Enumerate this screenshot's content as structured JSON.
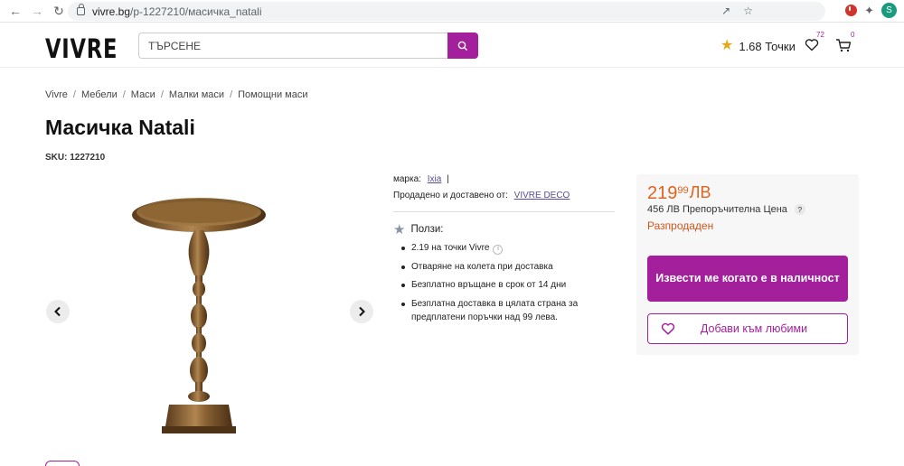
{
  "browser": {
    "url_host": "vivre.bg",
    "url_path": "/p-1227210/масичка_natali",
    "profile_initial": "S"
  },
  "header": {
    "logo": "VIVRE",
    "search_placeholder": "ТЪРСЕНЕ",
    "points": "1.68 Точки",
    "wishlist_count": "72",
    "cart_count": "0",
    "accent_color": "#a31f9c"
  },
  "breadcrumb": [
    "Vivre",
    "Мебели",
    "Маси",
    "Малки маси",
    "Помощни маси"
  ],
  "product": {
    "title": "Масичка Natali",
    "sku": "SKU: 1227210",
    "brand_label": "марка:",
    "brand": "Ixia",
    "brand_suffix": "|",
    "seller_label": "Продадено и доставено от:",
    "seller": "VIVRE DECO"
  },
  "benefits": {
    "title": "Ползи:",
    "items": [
      "2.19 на точки Vivre",
      "Отваряне на колета при доставка",
      "Безплатно връщане в срок от 14 дни",
      "Безплатна доставка в цялата страна за предплатени поръчки над 99 лева."
    ]
  },
  "price": {
    "main": "219",
    "cents": "99",
    "currency": "ЛВ",
    "rrp": "456 ЛВ Препоръчителна Цена",
    "rrp_help": "?",
    "status": "Разпродаден",
    "price_color": "#e0631e"
  },
  "actions": {
    "notify": "Извести ме когато е в наличност",
    "favorites": "Добави към любими"
  }
}
